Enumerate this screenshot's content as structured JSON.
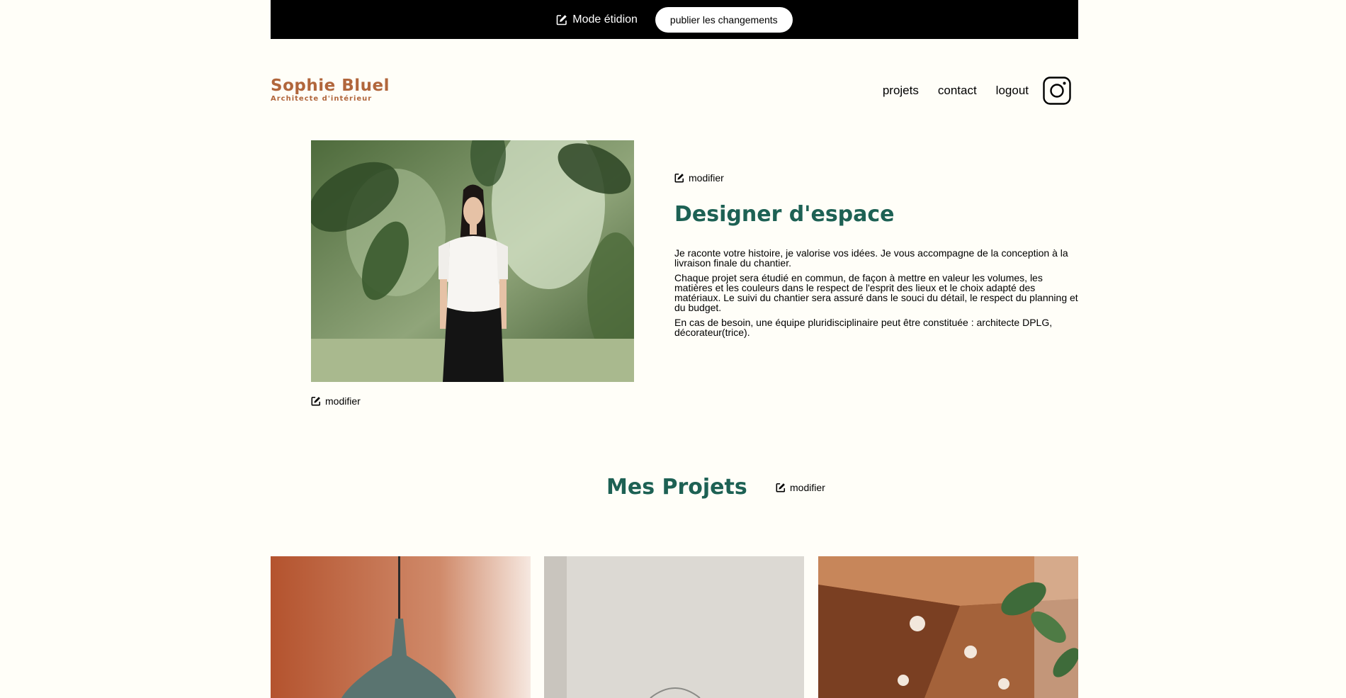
{
  "edit_bar": {
    "mode_label": "Mode étidion",
    "publish_label": "publier les changements"
  },
  "header": {
    "logo_name": "Sophie Bluel",
    "logo_subtitle": "Architecte d'intérieur",
    "nav": {
      "projects": "projets",
      "contact": "contact",
      "logout": "logout"
    },
    "social_icon": "instagram-icon"
  },
  "introduction": {
    "modify_label": "modifier",
    "title": "Designer d'espace",
    "paragraphs": [
      "Je raconte votre histoire, je valorise vos idées. Je vous accompagne de la conception à la livraison finale du chantier.",
      "Chaque projet sera étudié en commun, de façon à mettre en valeur les volumes, les matières et les couleurs dans le respect de l'esprit des lieux et le choix adapté des matériaux. Le suivi du chantier sera assuré dans le souci du détail, le respect du planning et du budget.",
      "En cas de besoin, une équipe pluridisciplinaire peut être constituée : architecte DPLG, décorateur(trice)."
    ]
  },
  "photo": {
    "modify_label": "modifier"
  },
  "projects": {
    "title": "Mes Projets",
    "modify_label": "modifier"
  },
  "colors": {
    "brand": "#B1663C",
    "heading": "#1D6154",
    "background": "#FFFEF8",
    "edit_bar": "#000000"
  }
}
